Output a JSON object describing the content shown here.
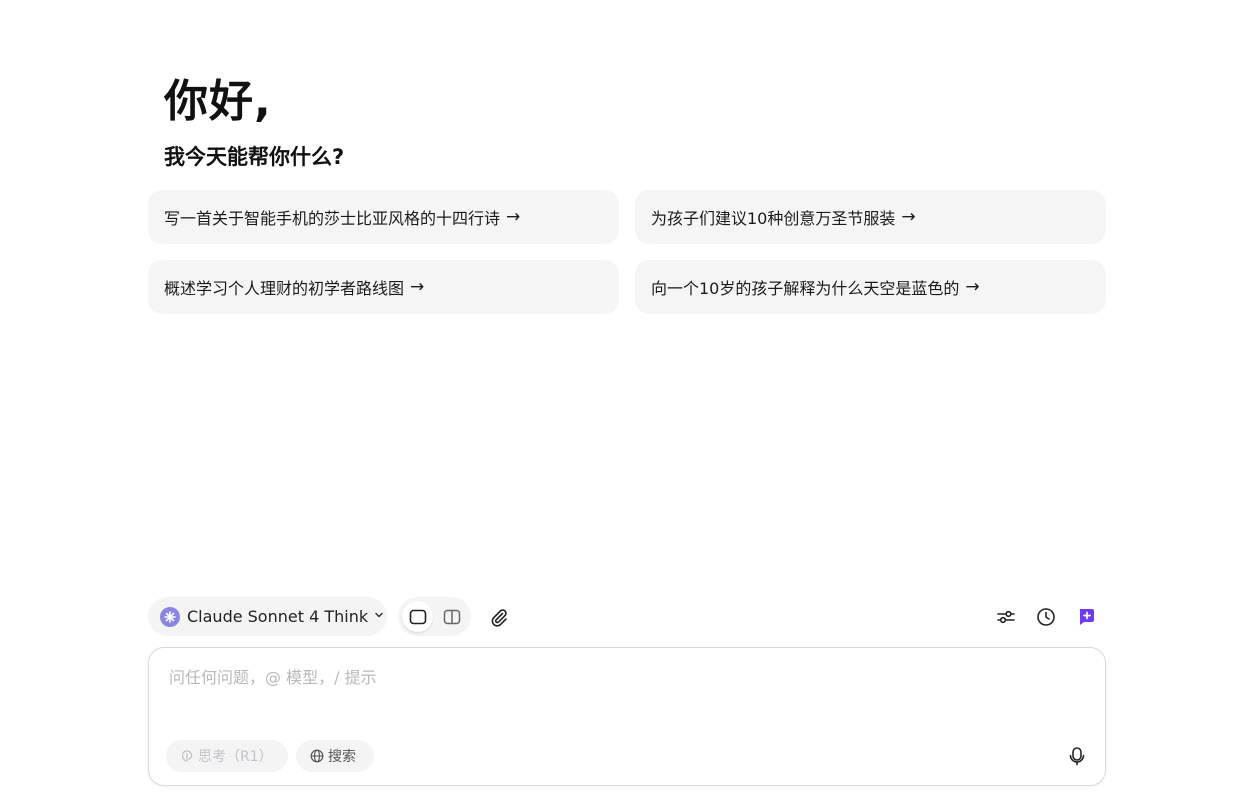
{
  "greeting": {
    "title": "你好,",
    "subtitle": "我今天能帮你什么?"
  },
  "suggestions": [
    {
      "label": "写一首关于智能手机的莎士比亚风格的十四行诗",
      "arrow": "→"
    },
    {
      "label": "为孩子们建议10种创意万圣节服装",
      "arrow": "→"
    },
    {
      "label": "概述学习个人理财的初学者路线图",
      "arrow": "→"
    },
    {
      "label": "向一个10岁的孩子解释为什么天空是蓝色的",
      "arrow": "→"
    }
  ],
  "toolbar": {
    "model_name": "Claude Sonnet 4 Think",
    "model_icon": "asterisk-icon",
    "chevron_icon": "chevron-down-icon",
    "layout_single_icon": "single-pane-icon",
    "layout_split_icon": "split-pane-icon",
    "attach_icon": "paperclip-icon",
    "settings_icon": "sliders-icon",
    "history_icon": "clock-icon",
    "new_chat_icon": "new-chat-icon"
  },
  "composer": {
    "placeholder": "问任何问题，@ 模型，/ 提示",
    "value": "",
    "think_label": "思考（R1）",
    "search_label": "搜索",
    "mic_icon": "microphone-icon"
  },
  "colors": {
    "accent": "#6d3cf2",
    "model_logo": "#8b84e0",
    "card_bg": "#f5f5f5"
  }
}
